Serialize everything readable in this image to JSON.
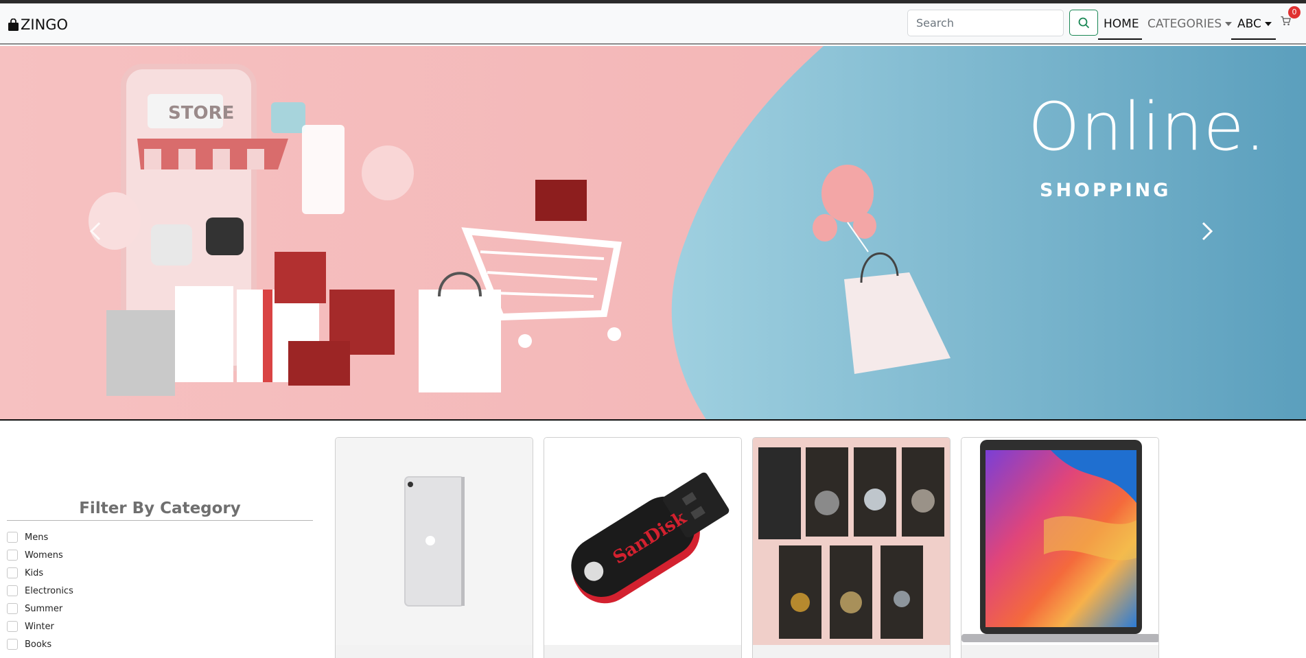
{
  "header": {
    "brand_name": "ZINGO",
    "brand_icon": "shopping-bag-icon",
    "search_placeholder": "Search",
    "search_value": "",
    "search_icon": "search-icon",
    "nav": {
      "home": "HOME",
      "categories": "CATEGORIES",
      "user": "ABC"
    },
    "cart_icon": "cart-icon",
    "cart_count": "0"
  },
  "carousel": {
    "title": "Online.",
    "subtitle": "SHOPPING",
    "store_sign": "STORE",
    "prev_icon": "chevron-left-icon",
    "next_icon": "chevron-right-icon"
  },
  "filter": {
    "title": "Filter By Category",
    "categories": [
      "Mens",
      "Womens",
      "Kids",
      "Electronics",
      "Summer",
      "Winter",
      "Books"
    ]
  },
  "products": [
    {
      "image": "ipad-image"
    },
    {
      "image": "usb-drive-image",
      "brand_text": "SanDisk"
    },
    {
      "image": "books-image"
    },
    {
      "image": "laptop-image"
    }
  ],
  "colors": {
    "accent_green": "#198754",
    "badge_red": "#e03131",
    "banner_pink": "#f3b5b6",
    "banner_blue": "#6fb3cc"
  }
}
